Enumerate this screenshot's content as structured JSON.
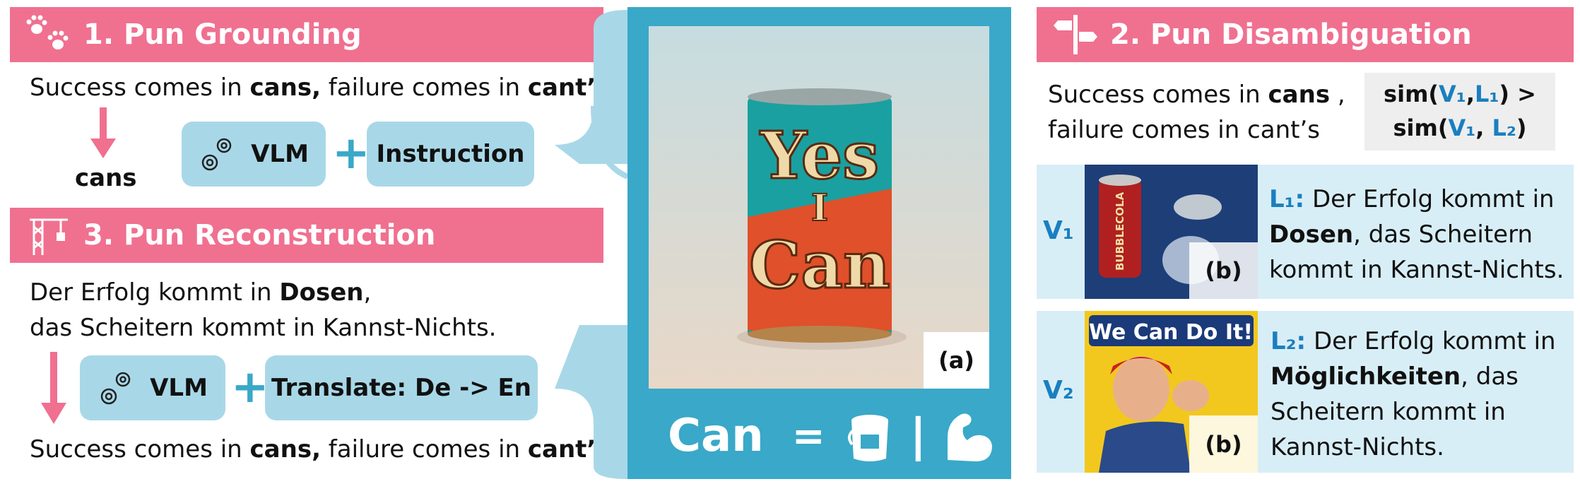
{
  "grounding": {
    "title": "1. Pun Grounding",
    "sentence_a": "Success comes in ",
    "sentence_b": "cans,",
    "sentence_c": " failure comes in ",
    "sentence_d": "cant’s",
    "output": "cans",
    "vlm": "VLM",
    "plus": "+",
    "instruction": "Instruction"
  },
  "reconstruction": {
    "title": "3. Pun Reconstruction",
    "line1_a": "Der Erfolg kommt in ",
    "line1_b": "Dosen",
    "line1_c": ",",
    "line2": "das Scheitern kommt in Kannst-Nichts.",
    "vlm": "VLM",
    "plus": "+",
    "translate": "Translate: De -> En",
    "out_a": "Success comes in ",
    "out_b": "cans,",
    "out_c": " failure comes in ",
    "out_d": "cant’s"
  },
  "center": {
    "can_text_1": "Yes",
    "can_text_2": "I",
    "can_text_3": "Can",
    "label_a": "(a)",
    "equation_word": "Can",
    "equation_eq": "=",
    "equation_bar": "|"
  },
  "disambiguation": {
    "title": "2. Pun Disambiguation",
    "sent1_a": "Success comes in ",
    "sent1_b": "cans",
    "sent1_c": " ,",
    "sent2": "failure comes in cant’s",
    "sim1_a": "sim(",
    "sim1_v": "V₁",
    "sim1_c": ",",
    "sim1_l": "L₁",
    "sim1_d": ") >",
    "sim2_a": "sim(",
    "sim2_v": "V₁",
    "sim2_c": ", ",
    "sim2_l": "L₂",
    "sim2_d": ")",
    "v1": "V₁",
    "v2": "V₂",
    "b_label": "(b)",
    "l1_key": "L₁:",
    "l1_line1": " Der Erfolg kommt in",
    "l1_bold": "Dosen",
    "l1_line2": ", das Scheitern",
    "l1_line3": "kommt in Kannst-Nichts.",
    "l2_key": "L₂:",
    "l2_line1": " Der Erfolg kommt in",
    "l2_bold": "Möglichkeiten",
    "l2_line2": ", das",
    "l2_line3": "Scheitern kommt in",
    "l2_line4": "Kannst-Nichts.",
    "poster_text": "We Can Do It!",
    "soda_text": "BUBBLECOLA"
  },
  "colors": {
    "header": "#f07090",
    "box": "#a8d8e8",
    "accent": "#3aa8c8",
    "label_blue": "#1a7fc0"
  }
}
